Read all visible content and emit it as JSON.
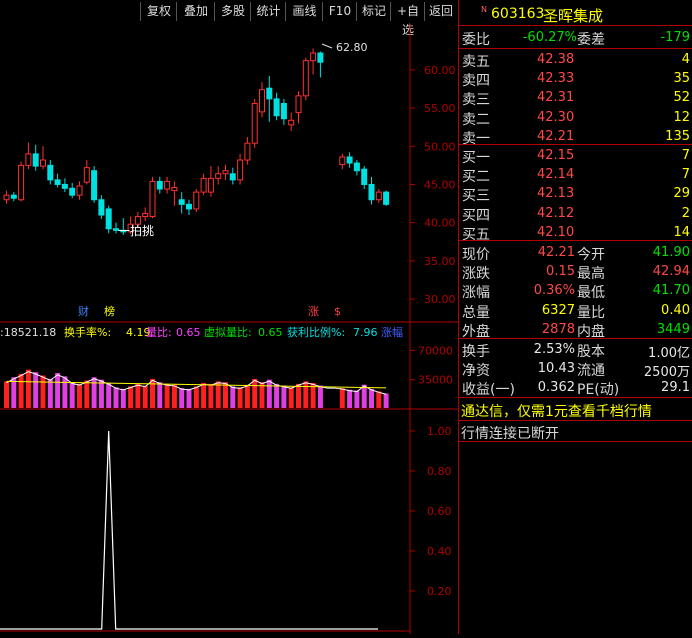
{
  "toolbar": {
    "buttons": [
      "复权",
      "叠加",
      "多股",
      "统计",
      "画线",
      "F10",
      "标记",
      "+自选",
      "返回"
    ]
  },
  "chart": {
    "peak_label": "62.80",
    "low_label": "一拍挑",
    "price_axis": [
      "60.00",
      "55.00",
      "50.00",
      "45.00",
      "40.00",
      "35.00",
      "30.00"
    ],
    "markers": [
      {
        "text": "财",
        "color": "#4080ff"
      },
      {
        "text": "榜",
        "color": "#ffff00"
      },
      {
        "text": "涨",
        "color": "#ff4040"
      },
      {
        "text": "$",
        "color": "#ff4040"
      }
    ],
    "volume_info": {
      "vol": ":18521.18",
      "turnover_label": "换手率%:",
      "turnover_val": "4.19",
      "ratio_label": "量比:",
      "ratio_val": "0.65",
      "vratio_label": "虚拟量比:",
      "vratio_val": "0.65",
      "profit_label": "获利比例%:",
      "profit_val": "7.96",
      "more": "涨幅"
    },
    "volume_axis": [
      "70000",
      "35000"
    ],
    "indicator_axis": [
      "1.00",
      "0.80",
      "0.60",
      "0.40",
      "0.20"
    ]
  },
  "chart_data": {
    "type": "candlestick",
    "price_ylim": [
      27,
      66
    ],
    "candles": [
      {
        "o": 43.0,
        "c": 43.6,
        "h": 44.2,
        "l": 42.5
      },
      {
        "o": 43.6,
        "c": 43.2,
        "h": 44.0,
        "l": 42.8
      },
      {
        "o": 43.0,
        "c": 47.5,
        "h": 48.0,
        "l": 42.8
      },
      {
        "o": 47.5,
        "c": 49.0,
        "h": 50.5,
        "l": 47.0
      },
      {
        "o": 49.0,
        "c": 47.4,
        "h": 50.2,
        "l": 46.8
      },
      {
        "o": 47.4,
        "c": 48.2,
        "h": 50.0,
        "l": 47.0
      },
      {
        "o": 47.5,
        "c": 45.6,
        "h": 48.2,
        "l": 45.0
      },
      {
        "o": 45.6,
        "c": 45.0,
        "h": 46.4,
        "l": 44.6
      },
      {
        "o": 45.0,
        "c": 44.5,
        "h": 45.8,
        "l": 44.0
      },
      {
        "o": 44.5,
        "c": 43.6,
        "h": 45.2,
        "l": 43.2
      },
      {
        "o": 43.6,
        "c": 44.8,
        "h": 45.4,
        "l": 43.0
      },
      {
        "o": 45.3,
        "c": 47.2,
        "h": 48.2,
        "l": 45.0
      },
      {
        "o": 46.8,
        "c": 43.0,
        "h": 47.4,
        "l": 42.6
      },
      {
        "o": 43.0,
        "c": 41.0,
        "h": 43.6,
        "l": 40.5
      },
      {
        "o": 41.8,
        "c": 39.2,
        "h": 42.2,
        "l": 38.6
      },
      {
        "o": 39.2,
        "c": 39.0,
        "h": 40.0,
        "l": 38.6
      },
      {
        "o": 39.0,
        "c": 38.8,
        "h": 40.6,
        "l": 38.4
      },
      {
        "o": 38.8,
        "c": 39.8,
        "h": 40.8,
        "l": 38.5
      },
      {
        "o": 39.8,
        "c": 40.8,
        "h": 41.4,
        "l": 39.4
      },
      {
        "o": 40.8,
        "c": 41.2,
        "h": 42.0,
        "l": 40.2
      },
      {
        "o": 40.8,
        "c": 45.4,
        "h": 46.0,
        "l": 40.6
      },
      {
        "o": 45.4,
        "c": 44.4,
        "h": 46.0,
        "l": 43.8
      },
      {
        "o": 44.4,
        "c": 45.4,
        "h": 46.0,
        "l": 43.8
      },
      {
        "o": 44.2,
        "c": 44.6,
        "h": 45.4,
        "l": 42.2
      },
      {
        "o": 43.0,
        "c": 42.4,
        "h": 44.0,
        "l": 41.2
      },
      {
        "o": 42.4,
        "c": 41.8,
        "h": 43.0,
        "l": 41.0
      },
      {
        "o": 41.8,
        "c": 44.0,
        "h": 44.4,
        "l": 41.4
      },
      {
        "o": 44.0,
        "c": 45.8,
        "h": 46.4,
        "l": 43.6
      },
      {
        "o": 44.0,
        "c": 45.8,
        "h": 47.4,
        "l": 43.4
      },
      {
        "o": 45.8,
        "c": 46.4,
        "h": 47.4,
        "l": 45.0
      },
      {
        "o": 46.4,
        "c": 46.8,
        "h": 47.6,
        "l": 45.6
      },
      {
        "o": 46.4,
        "c": 45.6,
        "h": 47.2,
        "l": 45.0
      },
      {
        "o": 45.6,
        "c": 48.2,
        "h": 49.0,
        "l": 45.0
      },
      {
        "o": 48.2,
        "c": 50.4,
        "h": 51.2,
        "l": 47.6
      },
      {
        "o": 50.4,
        "c": 55.6,
        "h": 56.2,
        "l": 49.8
      },
      {
        "o": 54.5,
        "c": 57.4,
        "h": 58.4,
        "l": 53.8
      },
      {
        "o": 57.6,
        "c": 56.2,
        "h": 59.2,
        "l": 53.2
      },
      {
        "o": 56.2,
        "c": 54.0,
        "h": 57.0,
        "l": 53.4
      },
      {
        "o": 55.6,
        "c": 53.6,
        "h": 56.2,
        "l": 52.8
      },
      {
        "o": 52.8,
        "c": 53.4,
        "h": 54.4,
        "l": 52.0
      },
      {
        "o": 54.4,
        "c": 56.6,
        "h": 57.2,
        "l": 53.0
      },
      {
        "o": 56.6,
        "c": 61.2,
        "h": 61.6,
        "l": 56.0
      },
      {
        "o": 61.2,
        "c": 62.2,
        "h": 62.8,
        "l": 59.4
      },
      {
        "o": 62.2,
        "c": 61.0,
        "h": 62.4,
        "l": 59.0
      },
      null,
      null,
      {
        "o": 47.6,
        "c": 48.6,
        "h": 49.0,
        "l": 47.0
      },
      {
        "o": 48.6,
        "c": 47.8,
        "h": 49.2,
        "l": 47.2
      },
      {
        "o": 47.8,
        "c": 46.8,
        "h": 48.2,
        "l": 46.2
      },
      {
        "o": 47.0,
        "c": 45.0,
        "h": 47.4,
        "l": 44.4
      },
      {
        "o": 45.0,
        "c": 43.0,
        "h": 46.0,
        "l": 42.4
      },
      {
        "o": 43.0,
        "c": 44.0,
        "h": 44.4,
        "l": 42.6
      },
      {
        "o": 44.0,
        "c": 42.4,
        "h": 44.2,
        "l": 42.2
      }
    ],
    "volumes": [
      33000,
      38000,
      42000,
      47000,
      44000,
      40000,
      36000,
      43000,
      39000,
      32000,
      30000,
      34000,
      38000,
      35000,
      31000,
      26000,
      24000,
      27000,
      30000,
      28000,
      36000,
      32000,
      30000,
      29000,
      25000,
      24000,
      27000,
      31000,
      30000,
      33000,
      32000,
      27000,
      26000,
      29000,
      36000,
      32000,
      35000,
      30000,
      28000,
      26000,
      30000,
      33000,
      31000,
      28000,
      null,
      null,
      25000,
      23000,
      22000,
      29000,
      24000,
      21000,
      18521
    ],
    "volume_ylim": [
      0,
      80000
    ],
    "indicator": {
      "ylim": [
        0,
        1.1
      ],
      "peak_index": 14,
      "peak_value": 1.0
    }
  },
  "quote": {
    "code": "603163",
    "name": "圣晖集成",
    "weibi_label": "委比",
    "weibi_val": "-60.27%",
    "weicha_label": "委差",
    "weicha_val": "-179",
    "asks": [
      {
        "label": "卖五",
        "price": "42.38",
        "vol": "4"
      },
      {
        "label": "卖四",
        "price": "42.33",
        "vol": "35"
      },
      {
        "label": "卖三",
        "price": "42.31",
        "vol": "52"
      },
      {
        "label": "卖二",
        "price": "42.30",
        "vol": "12"
      },
      {
        "label": "卖一",
        "price": "42.21",
        "vol": "135"
      }
    ],
    "bids": [
      {
        "label": "买一",
        "price": "42.15",
        "vol": "7"
      },
      {
        "label": "买二",
        "price": "42.14",
        "vol": "7"
      },
      {
        "label": "买三",
        "price": "42.13",
        "vol": "29"
      },
      {
        "label": "买四",
        "price": "42.12",
        "vol": "2"
      },
      {
        "label": "买五",
        "price": "42.10",
        "vol": "14"
      }
    ],
    "stats": [
      {
        "l1": "现价",
        "v1": "42.21",
        "c1": "red",
        "l2": "今开",
        "v2": "41.90",
        "c2": "green"
      },
      {
        "l1": "涨跌",
        "v1": "0.15",
        "c1": "red",
        "l2": "最高",
        "v2": "42.94",
        "c2": "red"
      },
      {
        "l1": "涨幅",
        "v1": "0.36%",
        "c1": "red",
        "l2": "最低",
        "v2": "41.70",
        "c2": "green"
      },
      {
        "l1": "总量",
        "v1": "6327",
        "c1": "yel",
        "l2": "量比",
        "v2": "0.40",
        "c2": "yel"
      },
      {
        "l1": "外盘",
        "v1": "2878",
        "c1": "red",
        "l2": "内盘",
        "v2": "3449",
        "c2": "green"
      }
    ],
    "extra": [
      {
        "l1": "换手",
        "v1": "2.53%",
        "l2": "股本",
        "v2": "1.00亿"
      },
      {
        "l1": "净资",
        "v1": "10.43",
        "l2": "流通",
        "v2": "2500万"
      },
      {
        "l1": "收益(一)",
        "v1": "0.362",
        "l2": "PE(动)",
        "v2": "29.1"
      }
    ],
    "notice": "通达信，仅需1元查看千档行情",
    "status": "行情连接已断开"
  },
  "colors": {
    "up": "#ff3030",
    "down": "#00e0e0",
    "axis": "#b00000"
  }
}
